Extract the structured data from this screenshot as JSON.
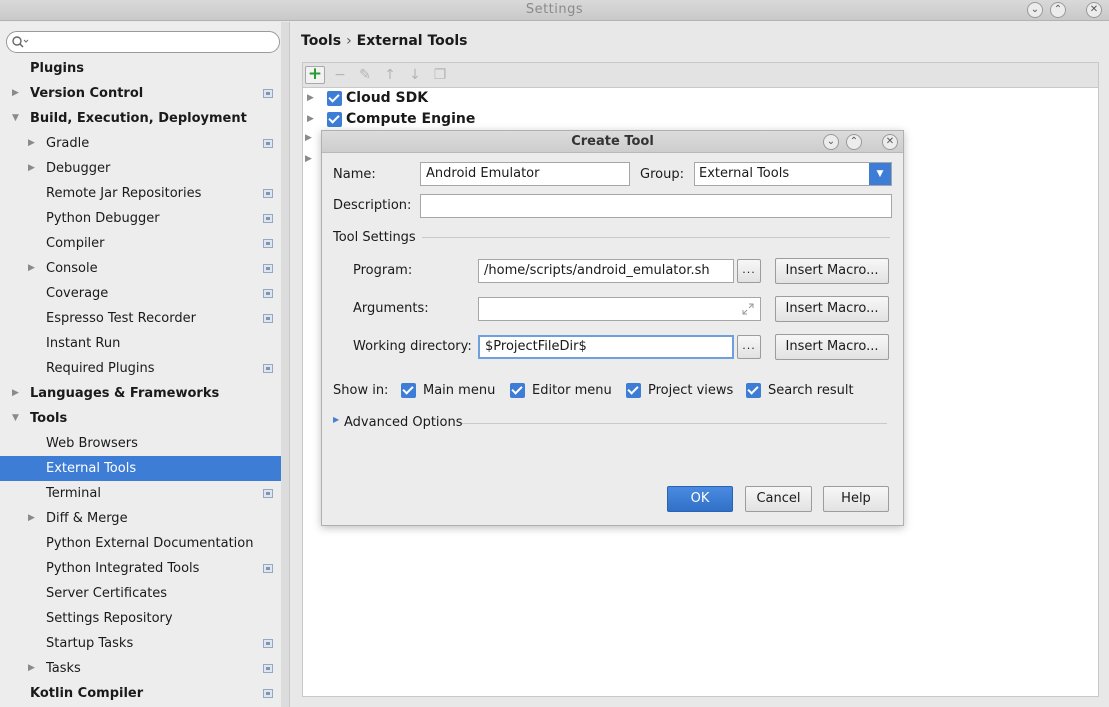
{
  "window": {
    "title": "Settings"
  },
  "sidebar": {
    "search_placeholder": "",
    "items": [
      {
        "label": "Plugins",
        "level": 0,
        "bold": true,
        "arrow": "",
        "pin": false
      },
      {
        "label": "Version Control",
        "level": 0,
        "bold": true,
        "arrow": "right",
        "pin": true
      },
      {
        "label": "Build, Execution, Deployment",
        "level": 0,
        "bold": true,
        "arrow": "down",
        "pin": false
      },
      {
        "label": "Gradle",
        "level": 1,
        "bold": false,
        "arrow": "right",
        "pin": true
      },
      {
        "label": "Debugger",
        "level": 1,
        "bold": false,
        "arrow": "right",
        "pin": false
      },
      {
        "label": "Remote Jar Repositories",
        "level": 1,
        "bold": false,
        "arrow": "",
        "pin": true
      },
      {
        "label": "Python Debugger",
        "level": 1,
        "bold": false,
        "arrow": "",
        "pin": true
      },
      {
        "label": "Compiler",
        "level": 1,
        "bold": false,
        "arrow": "",
        "pin": true
      },
      {
        "label": "Console",
        "level": 1,
        "bold": false,
        "arrow": "right",
        "pin": true
      },
      {
        "label": "Coverage",
        "level": 1,
        "bold": false,
        "arrow": "",
        "pin": true
      },
      {
        "label": "Espresso Test Recorder",
        "level": 1,
        "bold": false,
        "arrow": "",
        "pin": true
      },
      {
        "label": "Instant Run",
        "level": 1,
        "bold": false,
        "arrow": "",
        "pin": false
      },
      {
        "label": "Required Plugins",
        "level": 1,
        "bold": false,
        "arrow": "",
        "pin": true
      },
      {
        "label": "Languages & Frameworks",
        "level": 0,
        "bold": true,
        "arrow": "right",
        "pin": false
      },
      {
        "label": "Tools",
        "level": 0,
        "bold": true,
        "arrow": "down",
        "pin": false
      },
      {
        "label": "Web Browsers",
        "level": 1,
        "bold": false,
        "arrow": "",
        "pin": false
      },
      {
        "label": "External Tools",
        "level": 1,
        "bold": false,
        "arrow": "",
        "pin": false,
        "selected": true
      },
      {
        "label": "Terminal",
        "level": 1,
        "bold": false,
        "arrow": "",
        "pin": true
      },
      {
        "label": "Diff & Merge",
        "level": 1,
        "bold": false,
        "arrow": "right",
        "pin": false
      },
      {
        "label": "Python External Documentation",
        "level": 1,
        "bold": false,
        "arrow": "",
        "pin": false
      },
      {
        "label": "Python Integrated Tools",
        "level": 1,
        "bold": false,
        "arrow": "",
        "pin": true
      },
      {
        "label": "Server Certificates",
        "level": 1,
        "bold": false,
        "arrow": "",
        "pin": false
      },
      {
        "label": "Settings Repository",
        "level": 1,
        "bold": false,
        "arrow": "",
        "pin": false
      },
      {
        "label": "Startup Tasks",
        "level": 1,
        "bold": false,
        "arrow": "",
        "pin": true
      },
      {
        "label": "Tasks",
        "level": 1,
        "bold": false,
        "arrow": "right",
        "pin": true
      },
      {
        "label": "Kotlin Compiler",
        "level": 0,
        "bold": true,
        "arrow": "",
        "pin": true
      }
    ]
  },
  "breadcrumb": {
    "parent": "Tools",
    "separator": "›",
    "current": "External Tools"
  },
  "toolbar": {
    "add": "+",
    "remove": "−",
    "edit": "✎",
    "up": "↑",
    "down": "↓",
    "copy": "❐"
  },
  "tool_groups": [
    {
      "name": "Cloud SDK",
      "checked": true
    },
    {
      "name": "Compute Engine",
      "checked": true
    }
  ],
  "dialog": {
    "title": "Create Tool",
    "name_label": "Name:",
    "name_value": "Android Emulator",
    "group_label": "Group:",
    "group_value": "External Tools",
    "description_label": "Description:",
    "description_value": "",
    "tool_settings_label": "Tool Settings",
    "program_label": "Program:",
    "program_value": "/home/scripts/android_emulator.sh",
    "arguments_label": "Arguments:",
    "arguments_value": "",
    "workdir_label": "Working directory:",
    "workdir_value": "$ProjectFileDir$",
    "browse_label": "...",
    "insert_macro_label": "Insert Macro...",
    "show_in_label": "Show in:",
    "show_in": [
      {
        "label": "Main menu",
        "checked": true
      },
      {
        "label": "Editor menu",
        "checked": true
      },
      {
        "label": "Project views",
        "checked": true
      },
      {
        "label": "Search result",
        "checked": true
      }
    ],
    "advanced_label": "Advanced Options",
    "ok_label": "OK",
    "cancel_label": "Cancel",
    "help_label": "Help"
  },
  "colors": {
    "accent": "#3d7dd6",
    "add": "#2e9a32"
  }
}
